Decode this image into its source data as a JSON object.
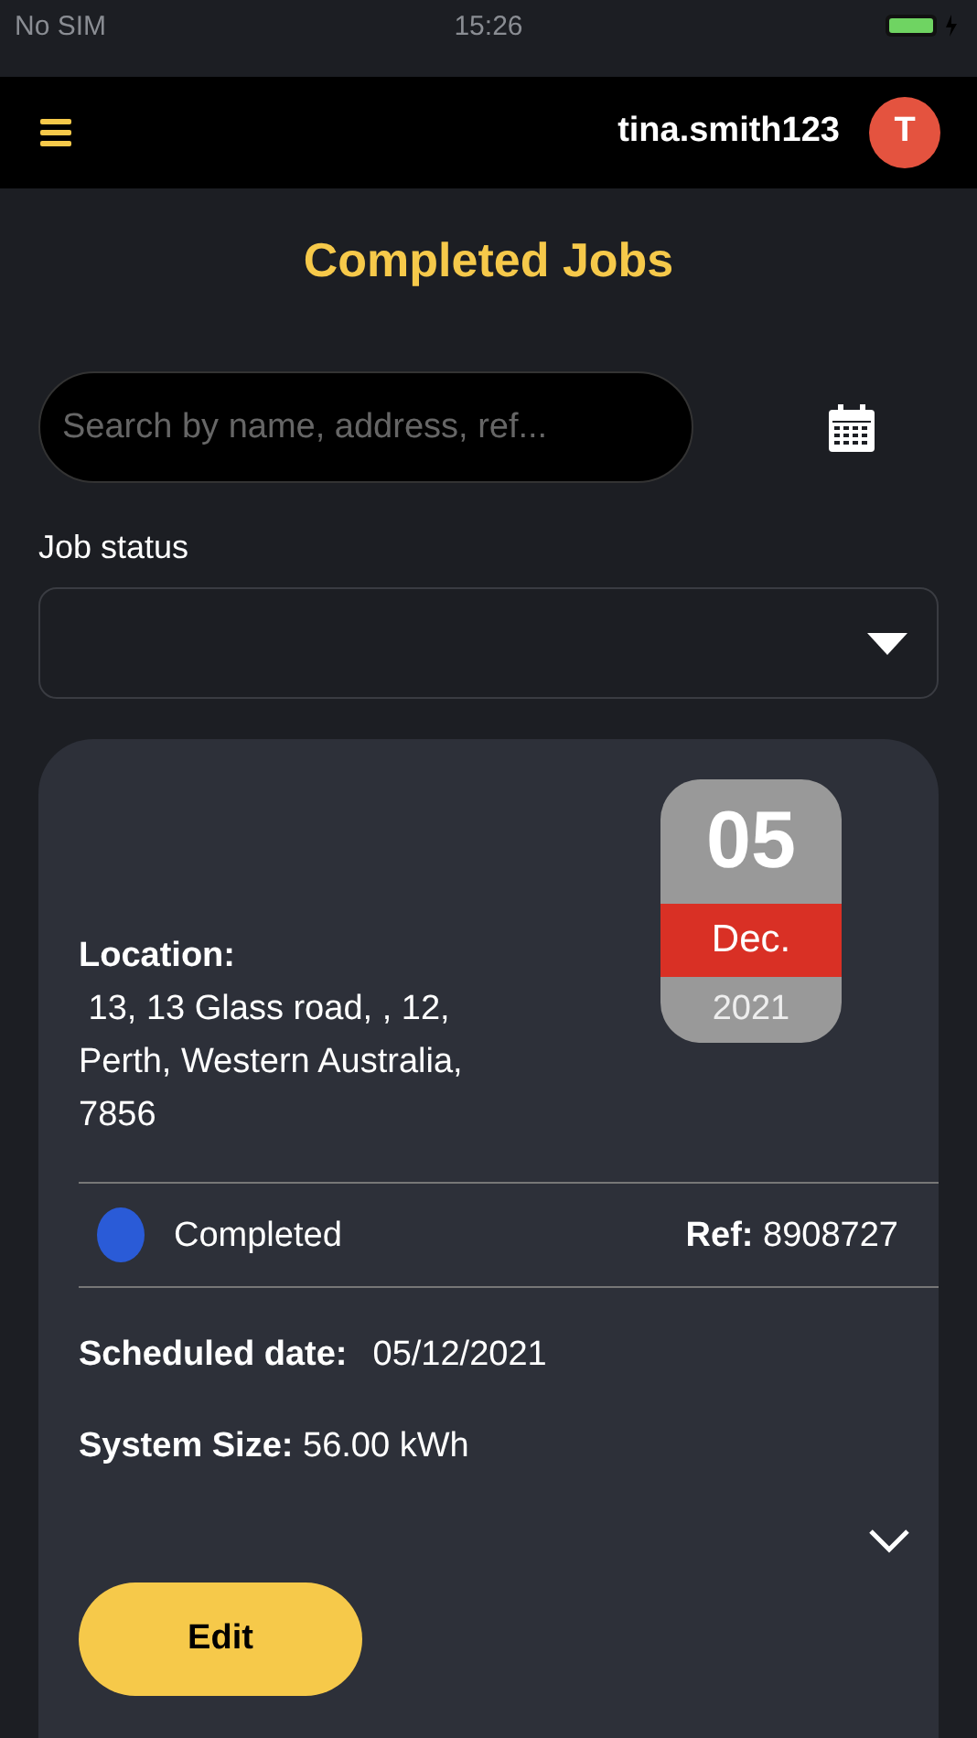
{
  "status_bar": {
    "carrier": "No SIM",
    "time": "15:26"
  },
  "header": {
    "username": "tina.smith123",
    "avatar_initial": "T"
  },
  "title": "Completed Jobs",
  "search": {
    "placeholder": "Search by name, address, ref..."
  },
  "job_status": {
    "label": "Job status"
  },
  "jobs": [
    {
      "location_label": "Location:",
      "address_lines": [
        " 13, 13 Glass road, , 12,",
        "Perth, Western Australia,",
        "7856"
      ],
      "date": {
        "day": "05",
        "month": "Dec.",
        "year": "2021"
      },
      "status": {
        "text": "Completed",
        "color": "#2a5bd7"
      },
      "ref": "**Ref:** 8908727",
      "scheduled_label": "Scheduled date:",
      "scheduled_value": "05/12/2021",
      "system_size": "**System Size:** 56.00 kWh",
      "expanded": false,
      "edit_button": "Edit"
    }
  ]
}
